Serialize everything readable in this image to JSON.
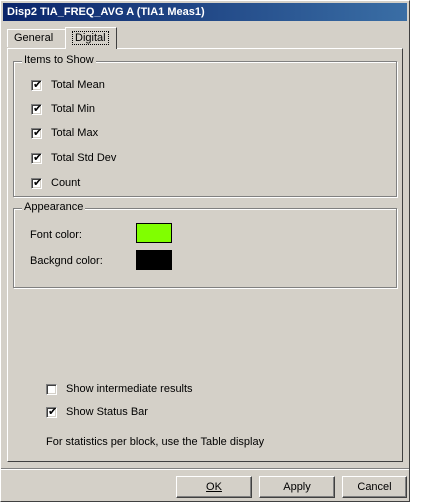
{
  "window": {
    "title": "Disp2 TIA_FREQ_AVG A (TIA1 Meas1)"
  },
  "tabs": [
    {
      "label": "General",
      "selected": false
    },
    {
      "label": "Digital",
      "selected": true
    }
  ],
  "items_group": {
    "label": "Items to Show",
    "items": [
      {
        "label": "Total Mean",
        "checked": true
      },
      {
        "label": "Total Min",
        "checked": true
      },
      {
        "label": "Total Max",
        "checked": true
      },
      {
        "label": "Total Std Dev",
        "checked": true
      },
      {
        "label": "Count",
        "checked": true
      }
    ]
  },
  "appearance": {
    "label": "Appearance",
    "font_color_label": "Font color:",
    "font_color": "#80ff00",
    "backgnd_color_label": "Backgnd color:",
    "backgnd_color": "#000000"
  },
  "options": {
    "intermediate": {
      "label": "Show intermediate results",
      "checked": false
    },
    "status_bar": {
      "label": "Show Status Bar",
      "checked": true
    }
  },
  "note": "For statistics per block, use the Table display",
  "buttons": {
    "ok": "OK",
    "apply": "Apply",
    "cancel": "Cancel"
  },
  "check_glyph": "✔"
}
